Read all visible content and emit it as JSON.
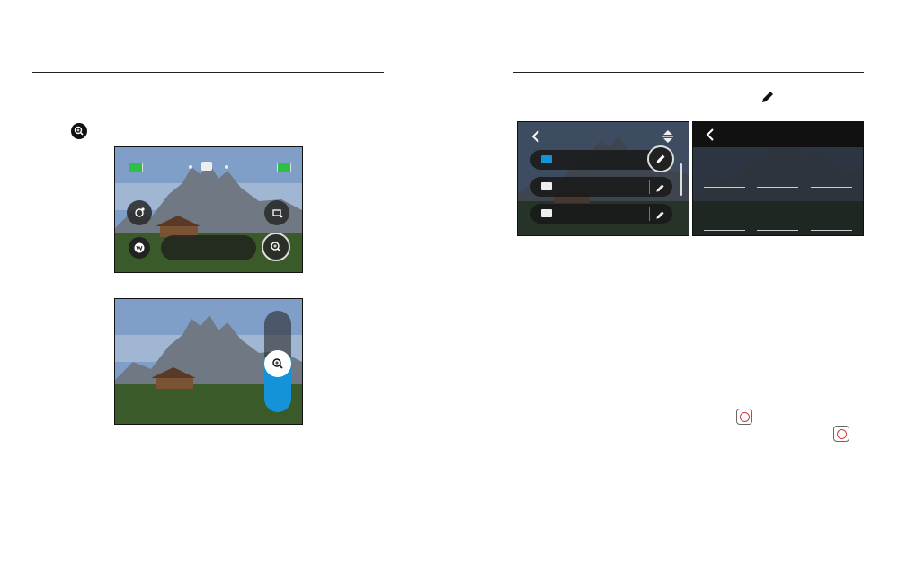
{
  "left_page": {},
  "right_page": {
    "screen_b": {
      "title": ""
    }
  },
  "colors": {
    "accent_blue": "#1593d8",
    "battery_green": "#2fbf45",
    "record_red": "#d23a3a"
  },
  "icons": [
    "zoom-icon",
    "pencil-icon",
    "back-chevron-icon",
    "record-icon"
  ]
}
